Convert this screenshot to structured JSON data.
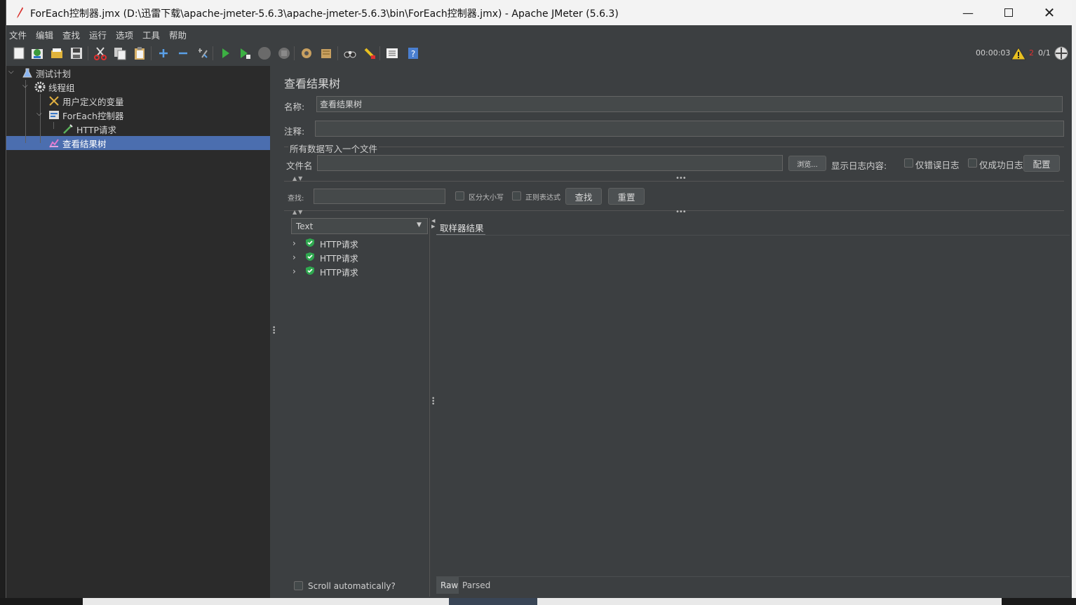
{
  "window": {
    "title": "ForEach控制器.jmx (D:\\迅雷下载\\apache-jmeter-5.6.3\\apache-jmeter-5.6.3\\bin\\ForEach控制器.jmx) - Apache JMeter (5.6.3)",
    "minimize_icon": "minimize-icon",
    "maximize_icon": "maximize-icon",
    "close_icon": "close-icon"
  },
  "menu": [
    "文件",
    "编辑",
    "查找",
    "运行",
    "选项",
    "工具",
    "帮助"
  ],
  "toolbar": {
    "icons": [
      "new-icon",
      "templates-icon",
      "open-icon",
      "save-icon",
      "cut-icon",
      "copy-icon",
      "paste-icon",
      "expand-icon",
      "collapse-icon",
      "toggle-icon",
      "start-icon",
      "start-no-pause-icon",
      "stop-icon",
      "shutdown-icon",
      "clear-icon",
      "clear-all-icon",
      "search-icon",
      "reset-search-icon",
      "function-helper-icon",
      "help-icon"
    ],
    "timer": "00:00:03",
    "warning_count": "2",
    "threads": "0/1"
  },
  "tree": [
    {
      "label": "测试计划",
      "icon": "flask-icon"
    },
    {
      "label": "线程组",
      "icon": "gear-icon"
    },
    {
      "label": "用户定义的变量",
      "icon": "tools-icon"
    },
    {
      "label": "ForEach控制器",
      "icon": "controller-icon"
    },
    {
      "label": "HTTP请求",
      "icon": "pipette-icon"
    },
    {
      "label": "查看结果树",
      "icon": "chart-icon"
    }
  ],
  "panel": {
    "title": "查看结果树",
    "name_label": "名称:",
    "name_value": "查看结果树",
    "comment_label": "注释:",
    "comment_value": "",
    "file_section": "所有数据写入一个文件",
    "filename_label": "文件名",
    "filename_value": "",
    "browse_button": "浏览...",
    "log_label": "显示日志内容:",
    "errors_only": "仅错误日志",
    "success_only": "仅成功日志",
    "configure_button": "配置",
    "search_label": "查找:",
    "search_value": "",
    "case_sensitive": "区分大小写",
    "regex": "正则表达式",
    "find_button": "查找",
    "reset_button": "重置",
    "renderer_selected": "Text",
    "results": [
      "HTTP请求",
      "HTTP请求",
      "HTTP请求"
    ],
    "result_tab": "取样器结果",
    "scroll_auto": "Scroll automatically?",
    "view_tabs": [
      "Raw",
      "Parsed"
    ]
  }
}
